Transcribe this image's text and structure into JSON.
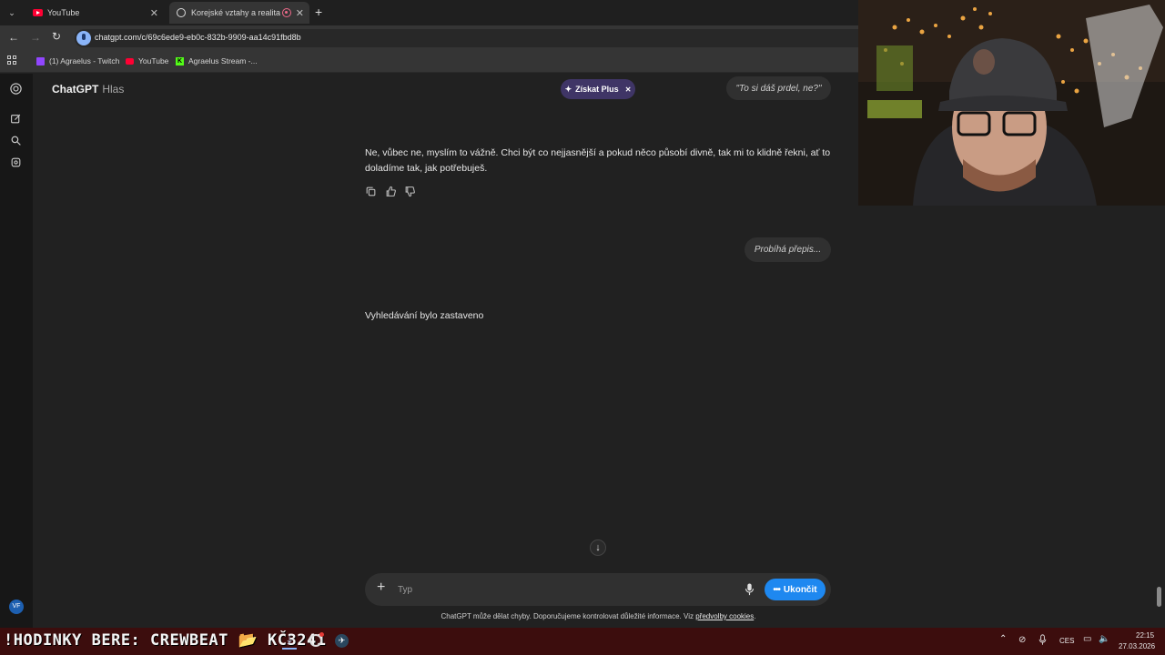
{
  "browser": {
    "tabs": [
      {
        "label": "YouTube",
        "active": false
      },
      {
        "label": "Korejské vztahy a realita",
        "active": true
      }
    ],
    "url": "chatgpt.com/c/69c6ede9-eb0c-832b-9909-aa14c91fbd8b",
    "bookmarks": [
      "(1) Agraelus - Twitch",
      "YouTube",
      "Agraelus Stream -..."
    ]
  },
  "header": {
    "title": "ChatGPT",
    "subtitle": "Hlas",
    "plus_label": "Získat Plus"
  },
  "conversation": {
    "user_bubble_1": "\"To si dáš prdel, ne?\"",
    "assistant_message": "Ne, vůbec ne, myslím to vážně. Chci být co nejjasnější a pokud něco působí divně, tak mi to klidně řekni, ať to doladíme tak, jak potřebuješ.",
    "user_bubble_2": "Probíhá přepis...",
    "status_text": "Vyhledávání bylo zastaveno"
  },
  "composer": {
    "placeholder": "Typ",
    "end_label": "Ukončit"
  },
  "footer": {
    "disclaimer": "ChatGPT může dělat chyby. Doporučujeme kontrolovat důležité informace. Viz",
    "cookies_link": "předvolby cookies",
    "period": "."
  },
  "user": {
    "initials": "VF"
  },
  "taskbar": {
    "overlay_text": "!HODINKY BERE: CREWBEAT 📂 KČ3241",
    "language": "CES",
    "time": "22:15",
    "date": "27.03.2026"
  },
  "colors": {
    "background": "#212121",
    "accent_blue": "#1e88f0",
    "plus_pill": "#3f3566",
    "taskbar": "#3c0d0d"
  }
}
